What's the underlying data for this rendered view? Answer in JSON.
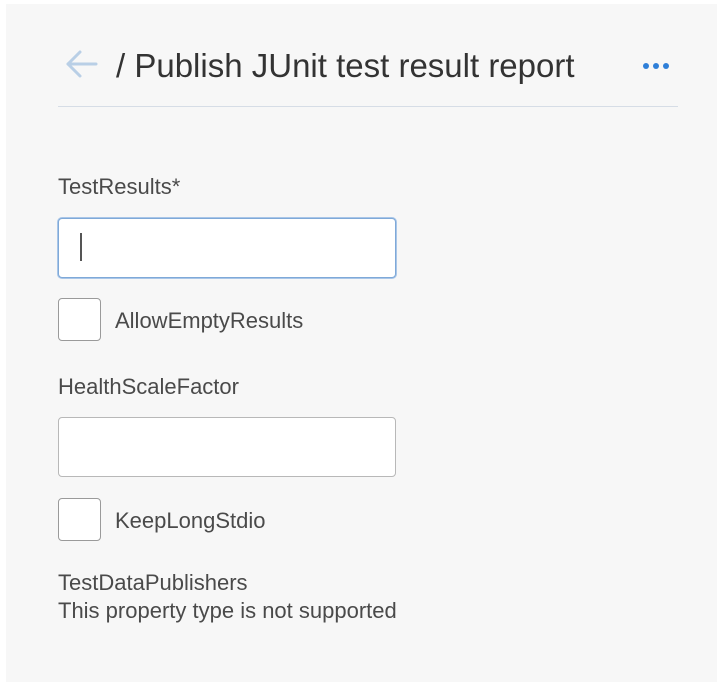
{
  "header": {
    "title": "/ Publish JUnit test result report",
    "back_icon": "arrow-left-icon",
    "more_icon": "more-horizontal-icon"
  },
  "form": {
    "test_results": {
      "label": "TestResults*",
      "value": "",
      "placeholder": ""
    },
    "allow_empty_results": {
      "label": "AllowEmptyResults",
      "checked": false
    },
    "health_scale_factor": {
      "label": "HealthScaleFactor",
      "value": "",
      "placeholder": ""
    },
    "keep_long_stdio": {
      "label": "KeepLongStdio",
      "checked": false
    },
    "test_data_publishers": {
      "label": "TestDataPublishers",
      "message": "This property type is not supported"
    }
  },
  "colors": {
    "accent": "#2f7fd8",
    "background": "#f7f7f7",
    "focus_border": "#7fa9d8"
  }
}
